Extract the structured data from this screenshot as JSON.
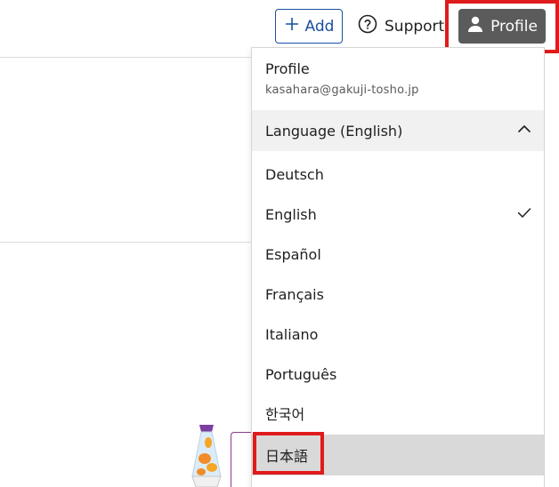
{
  "header": {
    "add_label": "Add",
    "support_label": "Support",
    "profile_label": "Profile"
  },
  "dropdown": {
    "profile_title": "Profile",
    "email": "kasahara@gakuji-tosho.jp",
    "language_header": "Language (English)",
    "languages": [
      {
        "label": "Deutsch",
        "selected": false
      },
      {
        "label": "English",
        "selected": true
      },
      {
        "label": "Español",
        "selected": false
      },
      {
        "label": "Français",
        "selected": false
      },
      {
        "label": "Italiano",
        "selected": false
      },
      {
        "label": "Português",
        "selected": false
      },
      {
        "label": "한국어",
        "selected": false
      },
      {
        "label": "日本語",
        "selected": false,
        "hovered": true
      }
    ]
  },
  "colors": {
    "accent": "#1a4fa3",
    "profile_bg": "#5b5b5b",
    "highlight": "#e01b1b",
    "hover_bg": "#d9d9d9",
    "header_bg": "#f1f1f1"
  }
}
